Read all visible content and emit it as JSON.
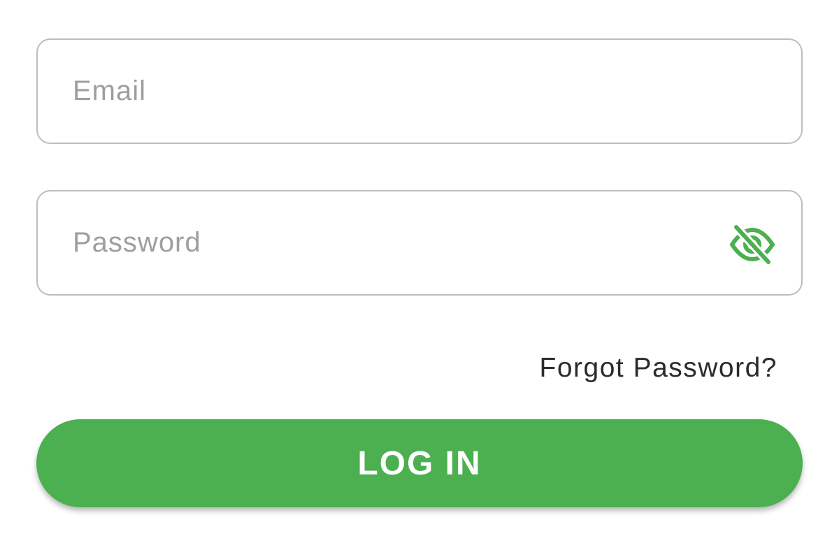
{
  "form": {
    "email": {
      "value": "",
      "placeholder": "Email"
    },
    "password": {
      "value": "",
      "placeholder": "Password",
      "toggle_icon": "eye-off-icon"
    },
    "forgot_password_label": "Forgot Password?",
    "login_label": "LOG IN"
  },
  "colors": {
    "accent": "#4caf50",
    "field_border": "#bdbdbd",
    "placeholder": "#9e9e9e",
    "link_text": "#2b2b2b"
  }
}
